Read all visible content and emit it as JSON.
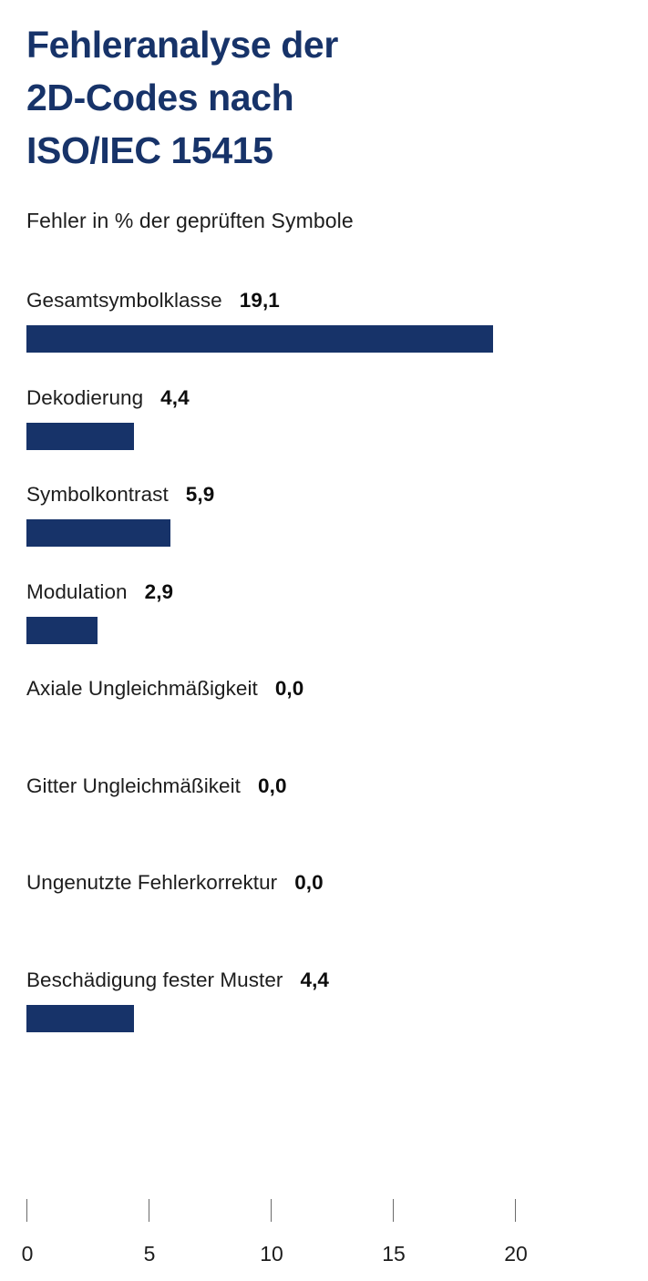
{
  "header": {
    "title": "Fehleranalyse der\n2D-Codes nach\nISO/IEC 15415",
    "title_plain": "Fehleranalyse der 2D-Codes nach ISO/IEC 15415",
    "subtitle": "Fehler in % der geprüften Symbole"
  },
  "colors": {
    "bar": "#173369",
    "title": "#173369",
    "text": "#1d1d1d",
    "tick": "#6b6b6b",
    "background": "#ffffff"
  },
  "chart_data": {
    "type": "bar",
    "orientation": "horizontal",
    "title": "Fehleranalyse der 2D-Codes nach ISO/IEC 15415",
    "subtitle": "Fehler in % der geprüften Symbole",
    "xlabel": "",
    "ylabel": "",
    "xlim": [
      0,
      20
    ],
    "grid": false,
    "legend": "none",
    "value_label_format": "german-decimal-comma",
    "categories": [
      "Gesamtsymbolklasse",
      "Dekodierung",
      "Symbolkontrast",
      "Modulation",
      "Axiale Ungleichmäßigkeit",
      "Gitter Ungleichmäßikeit",
      "Ungenutzte Fehlerkorrektur",
      "Beschädigung fester Muster"
    ],
    "values": [
      19.1,
      4.4,
      5.9,
      2.9,
      0.0,
      0.0,
      0.0,
      4.4
    ],
    "value_labels": [
      "19,1",
      "4,4",
      "5,9",
      "2,9",
      "0,0",
      "0,0",
      "0,0",
      "4,4"
    ],
    "xticks": [
      0,
      5,
      10,
      15,
      20
    ],
    "xtick_labels": [
      "0",
      "5",
      "10",
      "15",
      "20"
    ]
  }
}
